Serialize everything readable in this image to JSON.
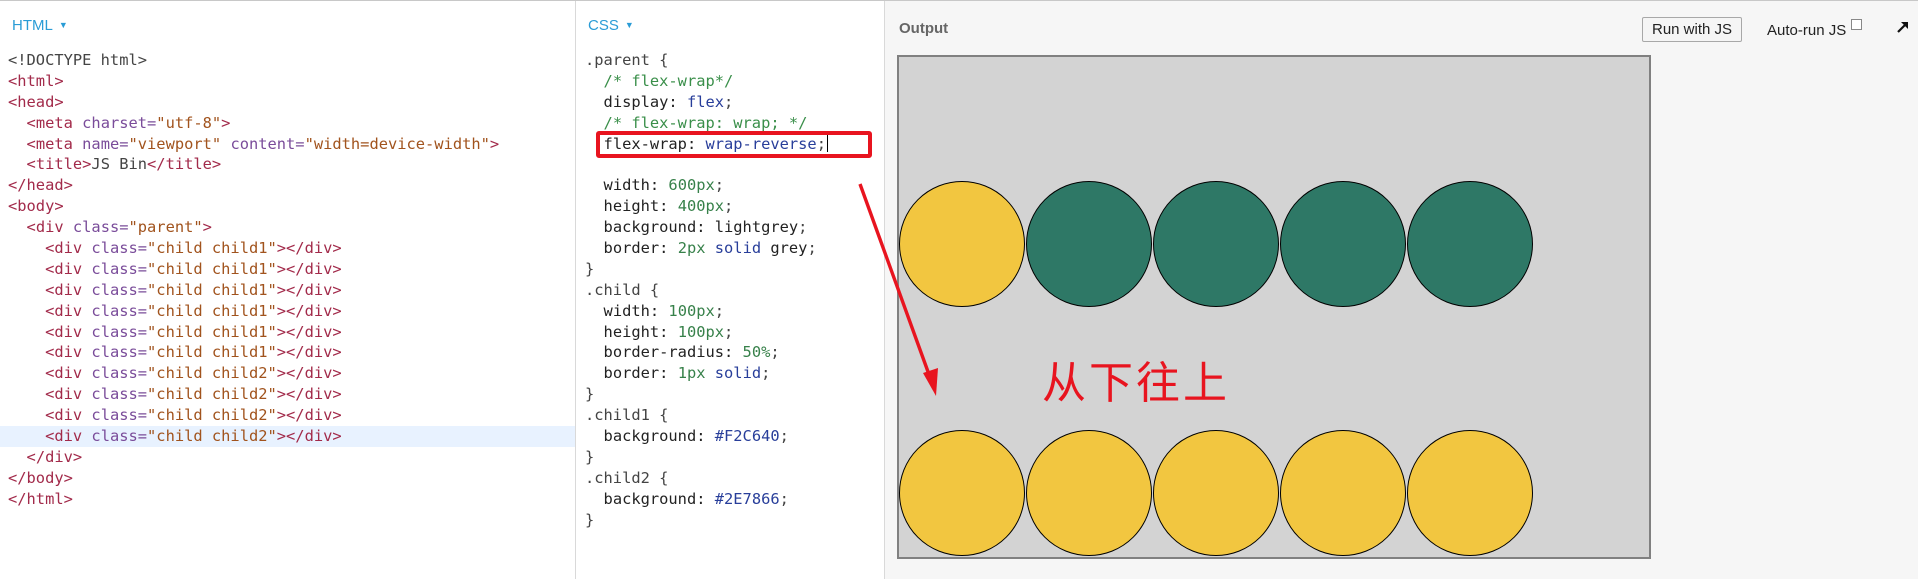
{
  "html_pane": {
    "label": "HTML",
    "dropdown_icon": "caret-down-icon",
    "lines": [
      [
        [
          "t-doc",
          "<!DOCTYPE html>"
        ]
      ],
      [
        [
          "t-tag",
          "<html>"
        ]
      ],
      [
        [
          "t-tag",
          "<head>"
        ]
      ],
      [
        [
          "t-pun",
          "  "
        ],
        [
          "t-tag",
          "<meta "
        ],
        [
          "t-attr",
          "charset="
        ],
        [
          "t-str",
          "\"utf-8\""
        ],
        [
          "t-tag",
          ">"
        ]
      ],
      [
        [
          "t-pun",
          "  "
        ],
        [
          "t-tag",
          "<meta "
        ],
        [
          "t-attr",
          "name="
        ],
        [
          "t-str",
          "\"viewport\""
        ],
        [
          "t-attr",
          " content="
        ],
        [
          "t-str",
          "\"width=device-width\""
        ],
        [
          "t-tag",
          ">"
        ]
      ],
      [
        [
          "t-pun",
          "  "
        ],
        [
          "t-tag",
          "<title>"
        ],
        [
          "t-doc",
          "JS Bin"
        ],
        [
          "t-tag",
          "</title>"
        ]
      ],
      [
        [
          "t-tag",
          "</head>"
        ]
      ],
      [
        [
          "t-tag",
          "<body>"
        ]
      ],
      [
        [
          "t-pun",
          "  "
        ],
        [
          "t-tag",
          "<div "
        ],
        [
          "t-attr",
          "class="
        ],
        [
          "t-str",
          "\"parent\""
        ],
        [
          "t-tag",
          ">"
        ]
      ],
      [
        [
          "t-pun",
          "    "
        ],
        [
          "t-tag",
          "<div "
        ],
        [
          "t-attr",
          "class="
        ],
        [
          "t-str",
          "\"child child1\""
        ],
        [
          "t-tag",
          "></div>"
        ]
      ],
      [
        [
          "t-pun",
          "    "
        ],
        [
          "t-tag",
          "<div "
        ],
        [
          "t-attr",
          "class="
        ],
        [
          "t-str",
          "\"child child1\""
        ],
        [
          "t-tag",
          "></div>"
        ]
      ],
      [
        [
          "t-pun",
          "    "
        ],
        [
          "t-tag",
          "<div "
        ],
        [
          "t-attr",
          "class="
        ],
        [
          "t-str",
          "\"child child1\""
        ],
        [
          "t-tag",
          "></div>"
        ]
      ],
      [
        [
          "t-pun",
          "    "
        ],
        [
          "t-tag",
          "<div "
        ],
        [
          "t-attr",
          "class="
        ],
        [
          "t-str",
          "\"child child1\""
        ],
        [
          "t-tag",
          "></div>"
        ]
      ],
      [
        [
          "t-pun",
          "    "
        ],
        [
          "t-tag",
          "<div "
        ],
        [
          "t-attr",
          "class="
        ],
        [
          "t-str",
          "\"child child1\""
        ],
        [
          "t-tag",
          "></div>"
        ]
      ],
      [
        [
          "t-pun",
          "    "
        ],
        [
          "t-tag",
          "<div "
        ],
        [
          "t-attr",
          "class="
        ],
        [
          "t-str",
          "\"child child1\""
        ],
        [
          "t-tag",
          "></div>"
        ]
      ],
      [
        [
          "t-pun",
          "    "
        ],
        [
          "t-tag",
          "<div "
        ],
        [
          "t-attr",
          "class="
        ],
        [
          "t-str",
          "\"child child2\""
        ],
        [
          "t-tag",
          "></div>"
        ]
      ],
      [
        [
          "t-pun",
          "    "
        ],
        [
          "t-tag",
          "<div "
        ],
        [
          "t-attr",
          "class="
        ],
        [
          "t-str",
          "\"child child2\""
        ],
        [
          "t-tag",
          "></div>"
        ]
      ],
      [
        [
          "t-pun",
          "    "
        ],
        [
          "t-tag",
          "<div "
        ],
        [
          "t-attr",
          "class="
        ],
        [
          "t-str",
          "\"child child2\""
        ],
        [
          "t-tag",
          "></div>"
        ]
      ],
      [
        [
          "t-pun",
          "    "
        ],
        [
          "t-tag",
          "<div "
        ],
        [
          "t-attr",
          "class="
        ],
        [
          "t-str",
          "\"child child2\""
        ],
        [
          "t-tag",
          "></div>"
        ]
      ],
      [
        [
          "t-pun",
          "  "
        ],
        [
          "t-tag",
          "</div>"
        ]
      ],
      [
        [
          "t-tag",
          "</body>"
        ]
      ],
      [
        [
          "t-tag",
          "</html>"
        ]
      ]
    ],
    "active_line": 18
  },
  "css_pane": {
    "label": "CSS",
    "dropdown_icon": "caret-down-icon",
    "lines": [
      [
        [
          "t-sel",
          ".parent {"
        ]
      ],
      [
        [
          "t-pun",
          "  "
        ],
        [
          "t-cmt",
          "/* flex-wrap*/"
        ]
      ],
      [
        [
          "t-pun",
          "  "
        ],
        [
          "t-prop",
          "display: "
        ],
        [
          "t-kw",
          "flex"
        ],
        [
          "t-pun",
          ";"
        ]
      ],
      [
        [
          "t-pun",
          "  "
        ],
        [
          "t-cmt",
          "/* flex-wrap: wrap; */"
        ]
      ],
      [
        [
          "t-pun",
          "  "
        ],
        [
          "t-prop",
          "flex-wrap: "
        ],
        [
          "t-kw",
          "wrap-reverse"
        ],
        [
          "t-pun",
          ";"
        ]
      ],
      [
        [
          "t-pun",
          ""
        ]
      ],
      [
        [
          "t-pun",
          "  "
        ],
        [
          "t-prop",
          "width: "
        ],
        [
          "t-num",
          "600px"
        ],
        [
          "t-pun",
          ";"
        ]
      ],
      [
        [
          "t-pun",
          "  "
        ],
        [
          "t-prop",
          "height: "
        ],
        [
          "t-num",
          "400px"
        ],
        [
          "t-pun",
          ";"
        ]
      ],
      [
        [
          "t-pun",
          "  "
        ],
        [
          "t-prop",
          "background: "
        ],
        [
          "t-prop",
          "lightgrey"
        ],
        [
          "t-pun",
          ";"
        ]
      ],
      [
        [
          "t-pun",
          "  "
        ],
        [
          "t-prop",
          "border: "
        ],
        [
          "t-num",
          "2px"
        ],
        [
          "t-kw",
          " solid"
        ],
        [
          "t-prop",
          " grey"
        ],
        [
          "t-pun",
          ";"
        ]
      ],
      [
        [
          "t-sel",
          "}"
        ]
      ],
      [
        [
          "t-sel",
          ".child {"
        ]
      ],
      [
        [
          "t-pun",
          "  "
        ],
        [
          "t-prop",
          "width: "
        ],
        [
          "t-num",
          "100px"
        ],
        [
          "t-pun",
          ";"
        ]
      ],
      [
        [
          "t-pun",
          "  "
        ],
        [
          "t-prop",
          "height: "
        ],
        [
          "t-num",
          "100px"
        ],
        [
          "t-pun",
          ";"
        ]
      ],
      [
        [
          "t-pun",
          "  "
        ],
        [
          "t-prop",
          "border-radius: "
        ],
        [
          "t-num",
          "50%"
        ],
        [
          "t-pun",
          ";"
        ]
      ],
      [
        [
          "t-pun",
          "  "
        ],
        [
          "t-prop",
          "border: "
        ],
        [
          "t-num",
          "1px"
        ],
        [
          "t-kw",
          " solid"
        ],
        [
          "t-pun",
          ";"
        ]
      ],
      [
        [
          "t-sel",
          "}"
        ]
      ],
      [
        [
          "t-sel",
          ".child1 {"
        ]
      ],
      [
        [
          "t-pun",
          "  "
        ],
        [
          "t-prop",
          "background: "
        ],
        [
          "t-hex",
          "#F2C640"
        ],
        [
          "t-pun",
          ";"
        ]
      ],
      [
        [
          "t-sel",
          "}"
        ]
      ],
      [
        [
          "t-sel",
          ".child2 {"
        ]
      ],
      [
        [
          "t-pun",
          "  "
        ],
        [
          "t-prop",
          "background: "
        ],
        [
          "t-hex",
          "#2E7866"
        ],
        [
          "t-pun",
          ";"
        ]
      ],
      [
        [
          "t-sel",
          "}"
        ]
      ]
    ],
    "highlighted_line": 4
  },
  "output_pane": {
    "title": "Output",
    "run_button": "Run with JS",
    "autorun_label": "Auto-run JS",
    "autorun_checked": false,
    "expand_icon": "expand-arrow-icon",
    "colors": {
      "child1": "#F2C640",
      "child2": "#2E7866",
      "frame_bg": "#D3D3D3",
      "frame_border": "#808080"
    },
    "top_row": [
      "child1",
      "child2",
      "child2",
      "child2",
      "child2"
    ],
    "bottom_row": [
      "child1",
      "child1",
      "child1",
      "child1",
      "child1"
    ]
  },
  "annotation": {
    "text": "从下往上",
    "color": "#E8141F"
  }
}
